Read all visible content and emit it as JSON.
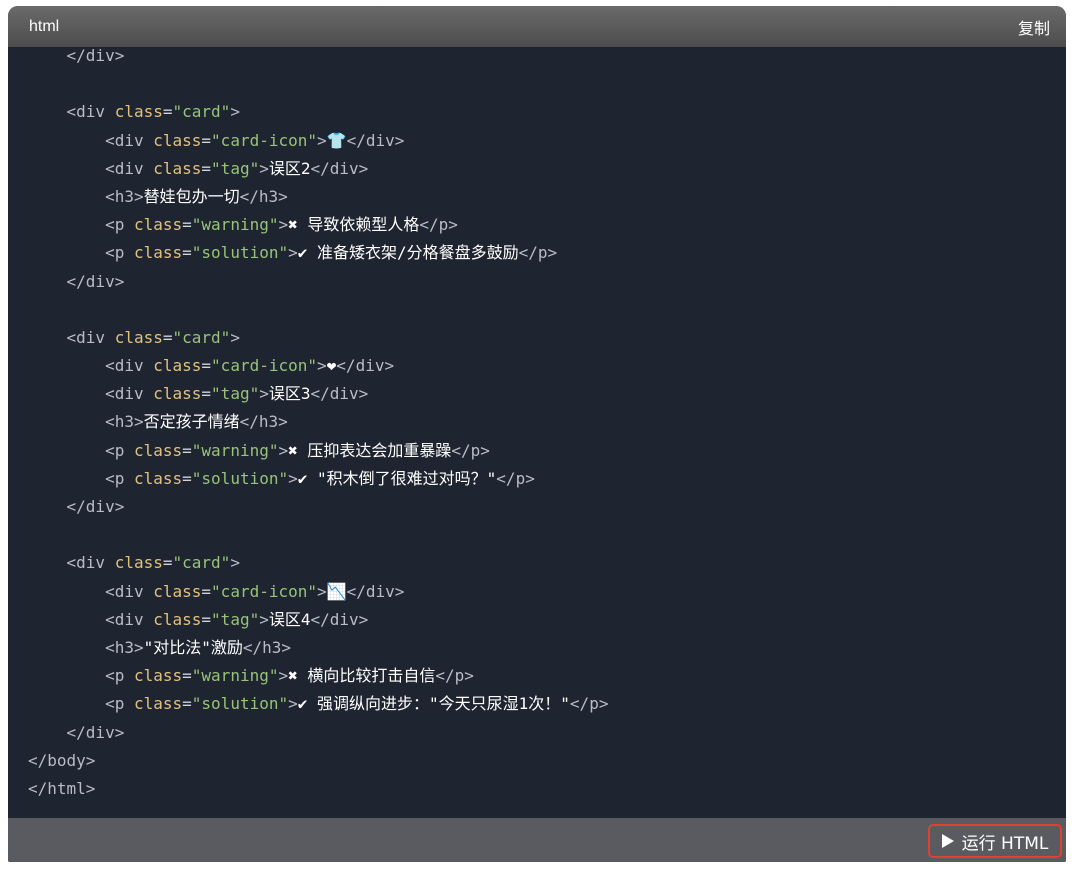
{
  "header": {
    "language": "html",
    "copy_label": "复制"
  },
  "footer": {
    "run_label": "运行 HTML"
  },
  "code_lines": [
    [
      {
        "t": "tag",
        "v": "    </div>"
      }
    ],
    [],
    [
      {
        "t": "tag",
        "v": "    <div "
      },
      {
        "t": "attr",
        "v": "class"
      },
      {
        "t": "eq",
        "v": "="
      },
      {
        "t": "str",
        "v": "\"card\""
      },
      {
        "t": "tag",
        "v": ">"
      }
    ],
    [
      {
        "t": "tag",
        "v": "        <div "
      },
      {
        "t": "attr",
        "v": "class"
      },
      {
        "t": "eq",
        "v": "="
      },
      {
        "t": "str",
        "v": "\"card-icon\""
      },
      {
        "t": "tag",
        "v": ">"
      },
      {
        "t": "text",
        "v": "👕"
      },
      {
        "t": "tag",
        "v": "</div>"
      }
    ],
    [
      {
        "t": "tag",
        "v": "        <div "
      },
      {
        "t": "attr",
        "v": "class"
      },
      {
        "t": "eq",
        "v": "="
      },
      {
        "t": "str",
        "v": "\"tag\""
      },
      {
        "t": "tag",
        "v": ">"
      },
      {
        "t": "text",
        "v": "误区2"
      },
      {
        "t": "tag",
        "v": "</div>"
      }
    ],
    [
      {
        "t": "tag",
        "v": "        <h3>"
      },
      {
        "t": "text",
        "v": "替娃包办一切"
      },
      {
        "t": "tag",
        "v": "</h3>"
      }
    ],
    [
      {
        "t": "tag",
        "v": "        <p "
      },
      {
        "t": "attr",
        "v": "class"
      },
      {
        "t": "eq",
        "v": "="
      },
      {
        "t": "str",
        "v": "\"warning\""
      },
      {
        "t": "tag",
        "v": ">"
      },
      {
        "t": "text",
        "v": "✖ 导致依赖型人格"
      },
      {
        "t": "tag",
        "v": "</p>"
      }
    ],
    [
      {
        "t": "tag",
        "v": "        <p "
      },
      {
        "t": "attr",
        "v": "class"
      },
      {
        "t": "eq",
        "v": "="
      },
      {
        "t": "str",
        "v": "\"solution\""
      },
      {
        "t": "tag",
        "v": ">"
      },
      {
        "t": "text",
        "v": "✔ 准备矮衣架/分格餐盘多鼓励"
      },
      {
        "t": "tag",
        "v": "</p>"
      }
    ],
    [
      {
        "t": "tag",
        "v": "    </div>"
      }
    ],
    [],
    [
      {
        "t": "tag",
        "v": "    <div "
      },
      {
        "t": "attr",
        "v": "class"
      },
      {
        "t": "eq",
        "v": "="
      },
      {
        "t": "str",
        "v": "\"card\""
      },
      {
        "t": "tag",
        "v": ">"
      }
    ],
    [
      {
        "t": "tag",
        "v": "        <div "
      },
      {
        "t": "attr",
        "v": "class"
      },
      {
        "t": "eq",
        "v": "="
      },
      {
        "t": "str",
        "v": "\"card-icon\""
      },
      {
        "t": "tag",
        "v": ">"
      },
      {
        "t": "text",
        "v": "❤"
      },
      {
        "t": "tag",
        "v": "</div>"
      }
    ],
    [
      {
        "t": "tag",
        "v": "        <div "
      },
      {
        "t": "attr",
        "v": "class"
      },
      {
        "t": "eq",
        "v": "="
      },
      {
        "t": "str",
        "v": "\"tag\""
      },
      {
        "t": "tag",
        "v": ">"
      },
      {
        "t": "text",
        "v": "误区3"
      },
      {
        "t": "tag",
        "v": "</div>"
      }
    ],
    [
      {
        "t": "tag",
        "v": "        <h3>"
      },
      {
        "t": "text",
        "v": "否定孩子情绪"
      },
      {
        "t": "tag",
        "v": "</h3>"
      }
    ],
    [
      {
        "t": "tag",
        "v": "        <p "
      },
      {
        "t": "attr",
        "v": "class"
      },
      {
        "t": "eq",
        "v": "="
      },
      {
        "t": "str",
        "v": "\"warning\""
      },
      {
        "t": "tag",
        "v": ">"
      },
      {
        "t": "text",
        "v": "✖ 压抑表达会加重暴躁"
      },
      {
        "t": "tag",
        "v": "</p>"
      }
    ],
    [
      {
        "t": "tag",
        "v": "        <p "
      },
      {
        "t": "attr",
        "v": "class"
      },
      {
        "t": "eq",
        "v": "="
      },
      {
        "t": "str",
        "v": "\"solution\""
      },
      {
        "t": "tag",
        "v": ">"
      },
      {
        "t": "text",
        "v": "✔ \"积木倒了很难过对吗？\""
      },
      {
        "t": "tag",
        "v": "</p>"
      }
    ],
    [
      {
        "t": "tag",
        "v": "    </div>"
      }
    ],
    [],
    [
      {
        "t": "tag",
        "v": "    <div "
      },
      {
        "t": "attr",
        "v": "class"
      },
      {
        "t": "eq",
        "v": "="
      },
      {
        "t": "str",
        "v": "\"card\""
      },
      {
        "t": "tag",
        "v": ">"
      }
    ],
    [
      {
        "t": "tag",
        "v": "        <div "
      },
      {
        "t": "attr",
        "v": "class"
      },
      {
        "t": "eq",
        "v": "="
      },
      {
        "t": "str",
        "v": "\"card-icon\""
      },
      {
        "t": "tag",
        "v": ">"
      },
      {
        "t": "text",
        "v": "📉"
      },
      {
        "t": "tag",
        "v": "</div>"
      }
    ],
    [
      {
        "t": "tag",
        "v": "        <div "
      },
      {
        "t": "attr",
        "v": "class"
      },
      {
        "t": "eq",
        "v": "="
      },
      {
        "t": "str",
        "v": "\"tag\""
      },
      {
        "t": "tag",
        "v": ">"
      },
      {
        "t": "text",
        "v": "误区4"
      },
      {
        "t": "tag",
        "v": "</div>"
      }
    ],
    [
      {
        "t": "tag",
        "v": "        <h3>"
      },
      {
        "t": "text",
        "v": "\"对比法\"激励"
      },
      {
        "t": "tag",
        "v": "</h3>"
      }
    ],
    [
      {
        "t": "tag",
        "v": "        <p "
      },
      {
        "t": "attr",
        "v": "class"
      },
      {
        "t": "eq",
        "v": "="
      },
      {
        "t": "str",
        "v": "\"warning\""
      },
      {
        "t": "tag",
        "v": ">"
      },
      {
        "t": "text",
        "v": "✖ 横向比较打击自信"
      },
      {
        "t": "tag",
        "v": "</p>"
      }
    ],
    [
      {
        "t": "tag",
        "v": "        <p "
      },
      {
        "t": "attr",
        "v": "class"
      },
      {
        "t": "eq",
        "v": "="
      },
      {
        "t": "str",
        "v": "\"solution\""
      },
      {
        "t": "tag",
        "v": ">"
      },
      {
        "t": "text",
        "v": "✔ 强调纵向进步：\"今天只尿湿1次！\""
      },
      {
        "t": "tag",
        "v": "</p>"
      }
    ],
    [
      {
        "t": "tag",
        "v": "    </div>"
      }
    ],
    [
      {
        "t": "tag",
        "v": "</body>"
      }
    ],
    [
      {
        "t": "tag",
        "v": "</html>"
      }
    ]
  ]
}
